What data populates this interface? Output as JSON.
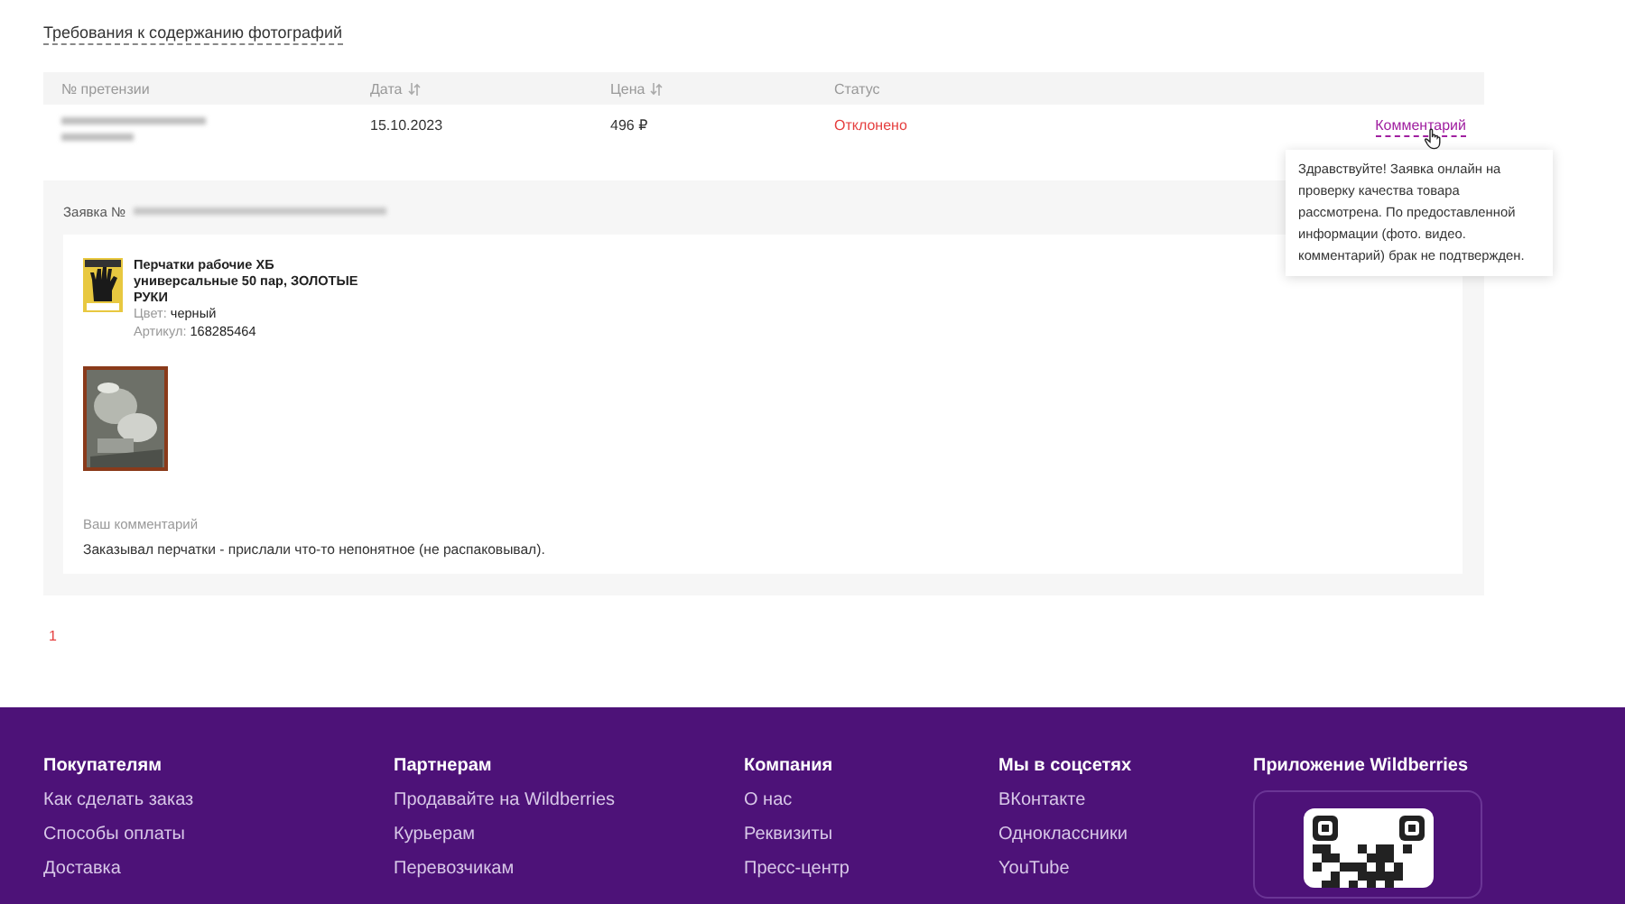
{
  "requirements_link": "Требования к содержанию фотографий",
  "table": {
    "columns": [
      {
        "label": "№ претензии",
        "sortable": false
      },
      {
        "label": "Дата",
        "sortable": true
      },
      {
        "label": "Цена",
        "sortable": true
      },
      {
        "label": "Статус",
        "sortable": false
      }
    ],
    "rows": [
      {
        "claim_redacted": true,
        "date": "15.10.2023",
        "price": "496 ₽",
        "status": "Отклонено",
        "color": "#e53e3e",
        "action": "Комментарий"
      }
    ]
  },
  "tooltip": {
    "text": "Здравствуйте! Заявка онлайн на проверку качества товара рассмотрена. По предоставленной информации (фото. видео. комментарий) брак не подтвержден."
  },
  "claim": {
    "label": "Заявка №",
    "number_redacted": true,
    "product": {
      "name": "Перчатки рабочие ХБ универсальные 50 пар, ЗОЛОТЫЕ РУКИ",
      "color_label": "Цвет:",
      "color_value": "черный",
      "article_label": "Артикул:",
      "article": "168285464"
    },
    "comment_label": "Ваш комментарий",
    "comment": "Заказывал перчатки - прислали что-то непонятное (не распаковывал)."
  },
  "pagination": [
    {
      "label": "1",
      "selected": true
    }
  ],
  "footer": {
    "columns": [
      {
        "title": "Покупателям",
        "links": [
          "Как сделать заказ",
          "Способы оплаты",
          "Доставка"
        ]
      },
      {
        "title": "Партнерам",
        "links": [
          "Продавайте на Wildberries",
          "Курьерам",
          "Перевозчикам"
        ]
      },
      {
        "title": "Компания",
        "links": [
          "О нас",
          "Реквизиты",
          "Пресс-центр"
        ]
      },
      {
        "title": "Мы в соцсетях",
        "links": [
          "ВКонтакте",
          "Одноклассники",
          "YouTube"
        ]
      }
    ],
    "app": {
      "title": "Приложение Wildberries"
    }
  }
}
